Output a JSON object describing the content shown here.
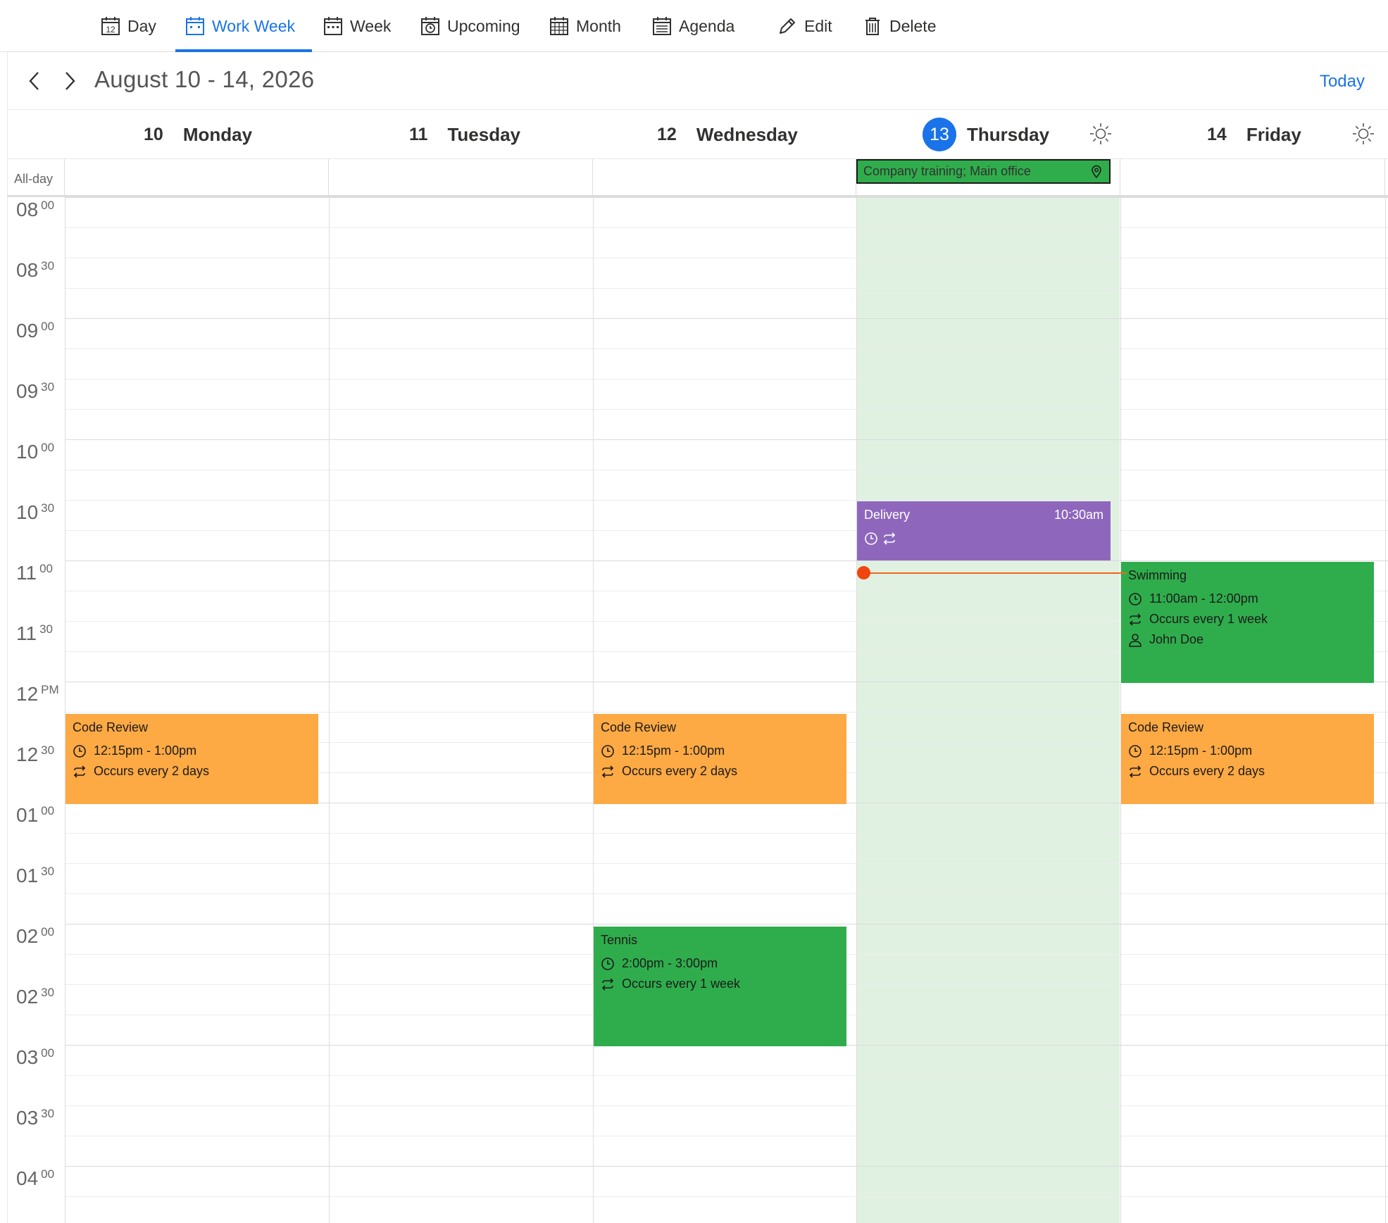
{
  "toolbar": {
    "views": [
      {
        "label": "Day",
        "icon": "calendar-day-icon"
      },
      {
        "label": "Work Week",
        "icon": "calendar-work-week-icon"
      },
      {
        "label": "Week",
        "icon": "calendar-week-icon"
      },
      {
        "label": "Upcoming",
        "icon": "calendar-upcoming-icon"
      },
      {
        "label": "Month",
        "icon": "calendar-month-icon"
      },
      {
        "label": "Agenda",
        "icon": "agenda-icon"
      }
    ],
    "active_view": "Work Week",
    "day_icon_number": "12",
    "edit_label": "Edit",
    "delete_label": "Delete"
  },
  "header": {
    "range": "August 10 - 14, 2026",
    "today_label": "Today"
  },
  "days": [
    {
      "num": "10",
      "name": "Monday"
    },
    {
      "num": "11",
      "name": "Tuesday"
    },
    {
      "num": "12",
      "name": "Wednesday"
    },
    {
      "num": "13",
      "name": "Thursday",
      "today": true,
      "weather_icon": "sun-icon"
    },
    {
      "num": "14",
      "name": "Friday",
      "weather_icon": "sun-icon"
    }
  ],
  "allday_label": "All-day",
  "allday_event": {
    "title": "Company training; Main office",
    "day": "Thursday",
    "icon": "location-pin-icon"
  },
  "time_labels": [
    {
      "h": "08",
      "m": "00"
    },
    {
      "h": "08",
      "m": "30"
    },
    {
      "h": "09",
      "m": "00"
    },
    {
      "h": "09",
      "m": "30"
    },
    {
      "h": "10",
      "m": "00"
    },
    {
      "h": "10",
      "m": "30"
    },
    {
      "h": "11",
      "m": "00"
    },
    {
      "h": "11",
      "m": "30"
    },
    {
      "h": "12",
      "m": "PM"
    },
    {
      "h": "12",
      "m": "30"
    },
    {
      "h": "01",
      "m": "00"
    },
    {
      "h": "01",
      "m": "30"
    },
    {
      "h": "02",
      "m": "00"
    },
    {
      "h": "02",
      "m": "30"
    },
    {
      "h": "03",
      "m": "00"
    },
    {
      "h": "03",
      "m": "30"
    },
    {
      "h": "04",
      "m": "00"
    }
  ],
  "events": {
    "delivery": {
      "title": "Delivery",
      "time": "10:30am"
    },
    "swimming": {
      "title": "Swimming",
      "time": "11:00am - 12:00pm",
      "recurrence": "Occurs every 1 week",
      "attendee": "John Doe"
    },
    "code_review_mon": {
      "title": "Code Review",
      "time": "12:15pm - 1:00pm",
      "recurrence": "Occurs every 2 days"
    },
    "code_review_wed": {
      "title": "Code Review",
      "time": "12:15pm - 1:00pm",
      "recurrence": "Occurs every 2 days"
    },
    "code_review_fri": {
      "title": "Code Review",
      "time": "12:15pm - 1:00pm",
      "recurrence": "Occurs every 2 days"
    },
    "tennis": {
      "title": "Tennis",
      "time": "2:00pm - 3:00pm",
      "recurrence": "Occurs every 1 week"
    }
  },
  "colors": {
    "accent": "#1a73e8",
    "today_column": "#e0f1e2",
    "event_orange": "#fda944",
    "event_green": "#2fad4c",
    "event_purple": "#8e67bd",
    "now_indicator": "#f0661d"
  }
}
